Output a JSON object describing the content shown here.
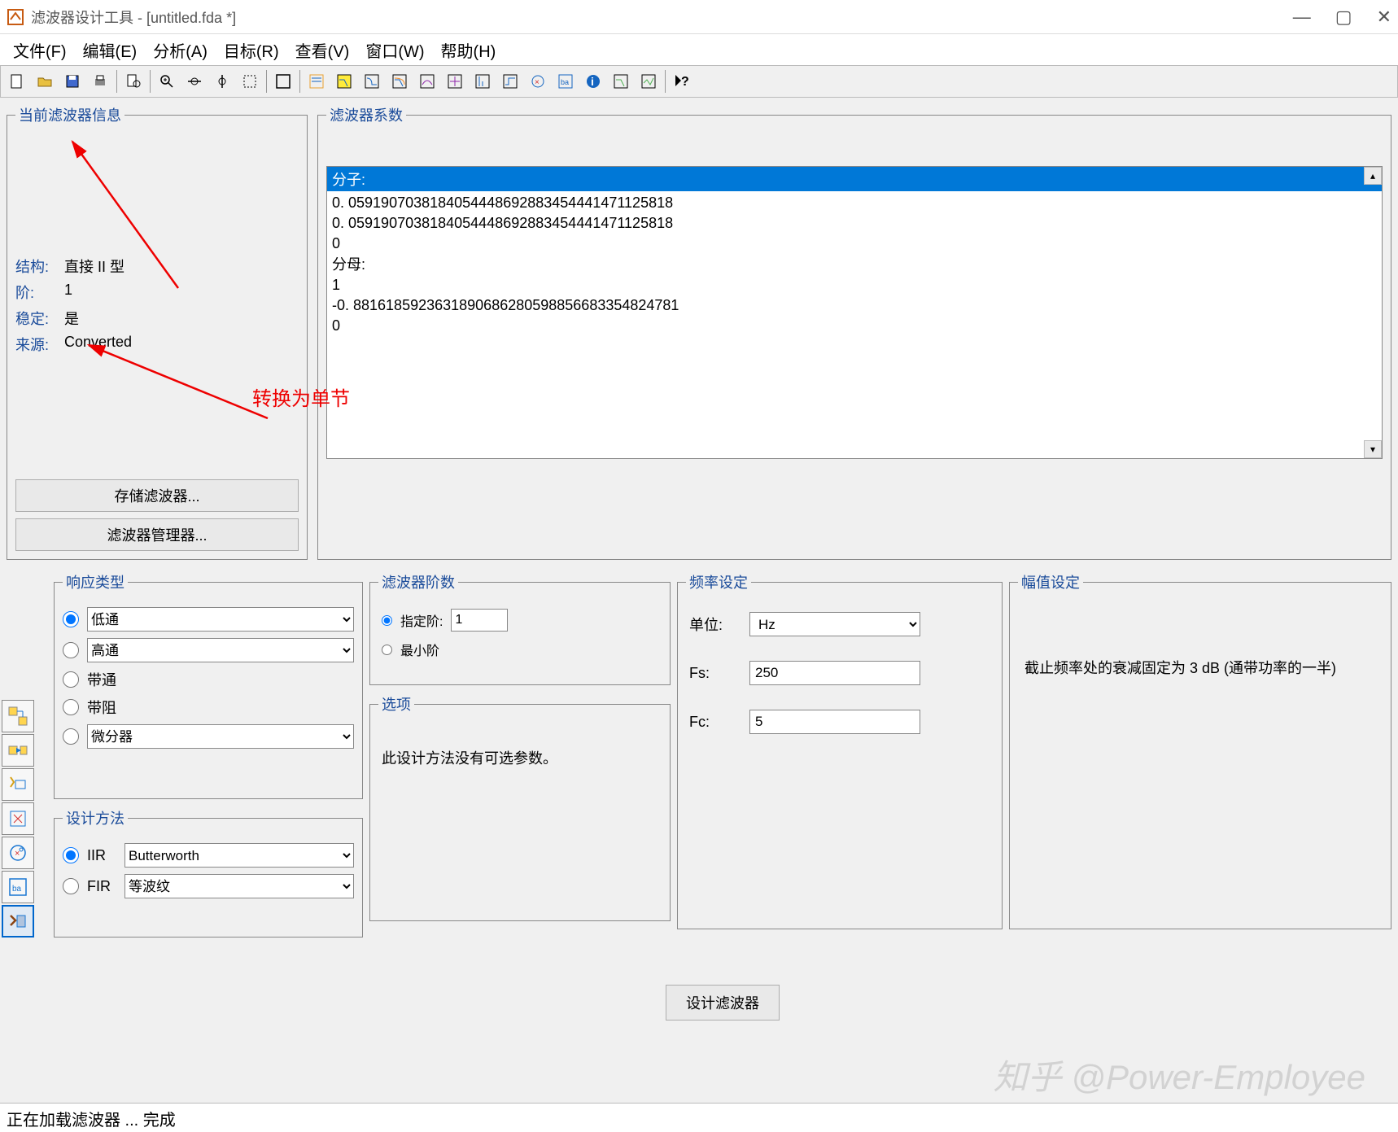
{
  "window": {
    "title": "滤波器设计工具 -  [untitled.fda *]"
  },
  "menu": {
    "file": "文件(F)",
    "edit": "编辑(E)",
    "analysis": "分析(A)",
    "target": "目标(R)",
    "view": "查看(V)",
    "window": "窗口(W)",
    "help": "帮助(H)"
  },
  "panels": {
    "filter_info_title": "当前滤波器信息",
    "coefs_title": "滤波器系数",
    "response_type_title": "响应类型",
    "design_method_title": "设计方法",
    "filter_order_title": "滤波器阶数",
    "options_title": "选项",
    "freq_title": "频率设定",
    "mag_title": "幅值设定"
  },
  "filter_info": {
    "structure_label": "结构:",
    "structure_value": "直接 II 型",
    "order_label": "阶:",
    "order_value": "1",
    "stable_label": "稳定:",
    "stable_value": "是",
    "source_label": "来源:",
    "source_value": "Converted",
    "store_btn": "存储滤波器...",
    "manager_btn": "滤波器管理器..."
  },
  "coefs": {
    "numerator_label": "分子:",
    "line1": "0. 0591907038184054448692883454441471125818",
    "line2": "0. 0591907038184054448692883454441471125818",
    "line3": "0",
    "denominator_label": "分母:",
    "line4": " 1",
    "line5": "-0. 8816185923631890686280598856683354824781",
    "line6": " 0"
  },
  "response": {
    "lowpass": "低通",
    "highpass": "高通",
    "bandpass": "带通",
    "bandstop": "带阻",
    "diff": "微分器"
  },
  "design": {
    "iir_label": "IIR",
    "iir_method": "Butterworth",
    "fir_label": "FIR",
    "fir_method": "等波纹"
  },
  "order": {
    "specify_label": "指定阶:",
    "specify_value": "1",
    "min_label": "最小阶"
  },
  "options": {
    "text": "此设计方法没有可选参数。"
  },
  "freq": {
    "unit_label": "单位:",
    "unit_value": "Hz",
    "fs_label": "Fs:",
    "fs_value": "250",
    "fc_label": "Fc:",
    "fc_value": "5"
  },
  "mag": {
    "text": "截止频率处的衰减固定为 3 dB (通带功率的一半)"
  },
  "design_btn": "设计滤波器",
  "status": "正在加载滤波器 ... 完成",
  "annotation": "转换为单节",
  "watermark": "知乎 @Power-Employee"
}
